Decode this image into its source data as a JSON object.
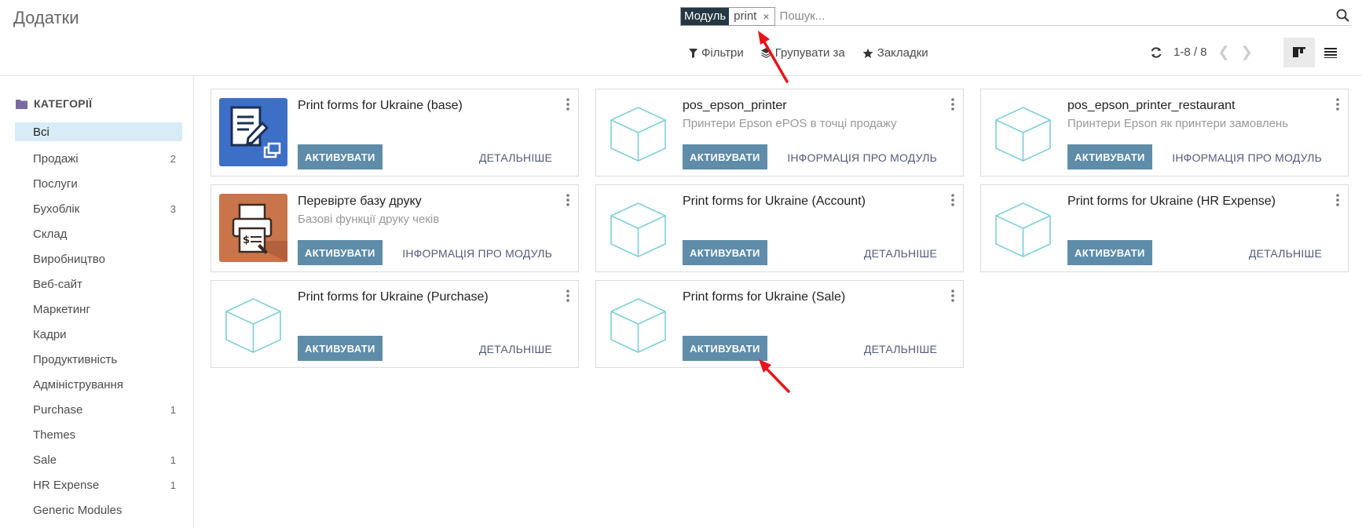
{
  "header": {
    "title": "Додатки",
    "search": {
      "facet_label": "Модуль",
      "facet_value": "print",
      "placeholder": "Пошук..."
    },
    "filters_label": "Фільтри",
    "group_by_label": "Групувати за",
    "favorites_label": "Закладки",
    "pager": "1-8 / 8"
  },
  "sidebar": {
    "header": "КАТЕГОРІЇ",
    "items": [
      {
        "label": "Всі",
        "count": ""
      },
      {
        "label": "Продажі",
        "count": "2"
      },
      {
        "label": "Послуги",
        "count": ""
      },
      {
        "label": "Бухоблік",
        "count": "3"
      },
      {
        "label": "Склад",
        "count": ""
      },
      {
        "label": "Виробництво",
        "count": ""
      },
      {
        "label": "Веб-сайт",
        "count": ""
      },
      {
        "label": "Маркетинг",
        "count": ""
      },
      {
        "label": "Кадри",
        "count": ""
      },
      {
        "label": "Продуктивність",
        "count": ""
      },
      {
        "label": "Адміністрування",
        "count": ""
      },
      {
        "label": "Purchase",
        "count": "1"
      },
      {
        "label": "Themes",
        "count": ""
      },
      {
        "label": "Sale",
        "count": "1"
      },
      {
        "label": "HR Expense",
        "count": "1"
      },
      {
        "label": "Generic Modules",
        "count": ""
      }
    ]
  },
  "modules": [
    {
      "title": "Print forms for Ukraine (base)",
      "summary": "",
      "activate": "АКТИВУВАТИ",
      "more": "ДЕТАЛЬНІШЕ",
      "icon": "document-edit-icon"
    },
    {
      "title": "pos_epson_printer",
      "summary": "Принтери Epson ePOS в точці продажу",
      "activate": "АКТИВУВАТИ",
      "more": "ІНФОРМАЦІЯ ПРО МОДУЛЬ",
      "icon": "cube-icon"
    },
    {
      "title": "pos_epson_printer_restaurant",
      "summary": "Принтери Epson як принтери замовлень",
      "activate": "АКТИВУВАТИ",
      "more": "ІНФОРМАЦІЯ ПРО МОДУЛЬ",
      "icon": "cube-icon"
    },
    {
      "title": "Перевірте базу друку",
      "summary": "Базові функції друку чеків",
      "activate": "АКТИВУВАТИ",
      "more": "ІНФОРМАЦІЯ ПРО МОДУЛЬ",
      "icon": "check-printer-icon"
    },
    {
      "title": "Print forms for Ukraine (Account)",
      "summary": "",
      "activate": "АКТИВУВАТИ",
      "more": "ДЕТАЛЬНІШЕ",
      "icon": "cube-icon"
    },
    {
      "title": "Print forms for Ukraine (HR Expense)",
      "summary": "",
      "activate": "АКТИВУВАТИ",
      "more": "ДЕТАЛЬНІШЕ",
      "icon": "cube-icon"
    },
    {
      "title": "Print forms for Ukraine (Purchase)",
      "summary": "",
      "activate": "АКТИВУВАТИ",
      "more": "ДЕТАЛЬНІШЕ",
      "icon": "cube-icon"
    },
    {
      "title": "Print forms for Ukraine (Sale)",
      "summary": "",
      "activate": "АКТИВУВАТИ",
      "more": "ДЕТАЛЬНІШЕ",
      "icon": "cube-icon"
    }
  ],
  "colors": {
    "accent": "#5e8ca9",
    "facet_dark": "#243742",
    "sidebar_active": "#d8ecf7",
    "annotation": "#e8141b"
  }
}
